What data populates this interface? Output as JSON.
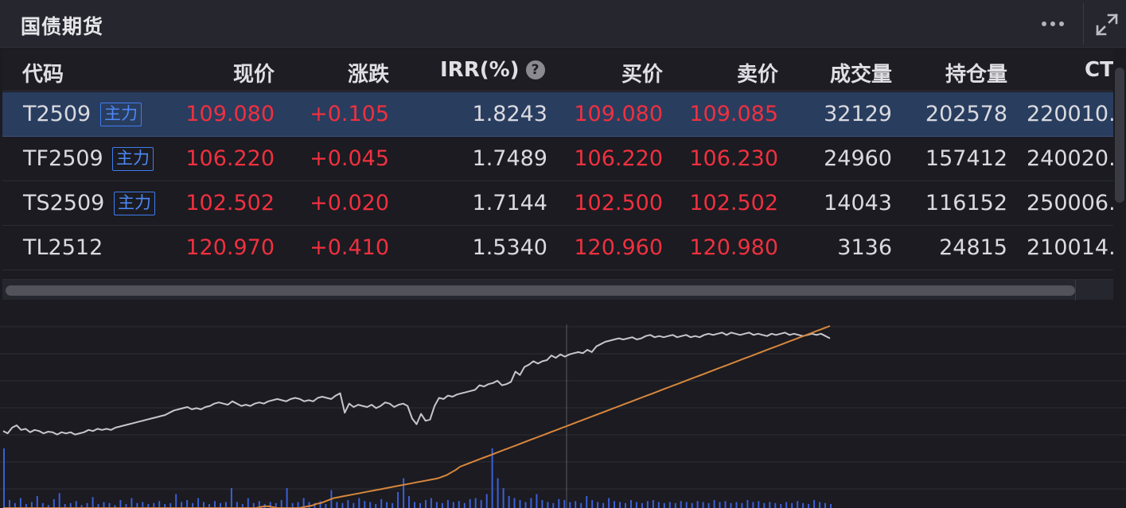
{
  "header": {
    "title": "国债期货",
    "more_icon": "more-dots-icon",
    "expand_icon": "expand-arrows-icon"
  },
  "table": {
    "columns": {
      "code": "代码",
      "price": "现价",
      "change": "涨跌",
      "irr": "IRR(%)",
      "irr_help": "?",
      "bid": "买价",
      "ask": "卖价",
      "volume": "成交量",
      "open_interest": "持仓量",
      "ctd": "CT"
    },
    "rows": [
      {
        "code": "T2509",
        "tag": "主力",
        "price": "109.080",
        "change": "+0.105",
        "irr": "1.8243",
        "bid": "109.080",
        "ask": "109.085",
        "volume": "32129",
        "open_interest": "202578",
        "ctd": "220010."
      },
      {
        "code": "TF2509",
        "tag": "主力",
        "price": "106.220",
        "change": "+0.045",
        "irr": "1.7489",
        "bid": "106.220",
        "ask": "106.230",
        "volume": "24960",
        "open_interest": "157412",
        "ctd": "240020."
      },
      {
        "code": "TS2509",
        "tag": "主力",
        "price": "102.502",
        "change": "+0.020",
        "irr": "1.7144",
        "bid": "102.500",
        "ask": "102.502",
        "volume": "14043",
        "open_interest": "116152",
        "ctd": "250006."
      },
      {
        "code": "TL2512",
        "tag": "",
        "price": "120.970",
        "change": "+0.410",
        "irr": "1.5340",
        "bid": "120.960",
        "ask": "120.980",
        "volume": "3136",
        "open_interest": "24815",
        "ctd": "210014."
      }
    ],
    "selected_row": 0
  },
  "colors": {
    "up": "#f0303f",
    "tag": "#4d88f5",
    "selected_row": "#293d5f",
    "price_line": "#c6c6cc",
    "avg_line": "#d8873c",
    "volume_bar": "#3b5fd6"
  },
  "chart_data": {
    "type": "line",
    "grid": true,
    "series": [
      {
        "values": [
          0.48,
          0.44,
          0.54,
          0.58,
          0.5,
          0.52,
          0.46,
          0.5,
          0.48,
          0.44,
          0.47,
          0.46,
          0.42,
          0.46,
          0.44,
          0.46,
          0.42,
          0.44,
          0.46,
          0.5,
          0.48,
          0.52,
          0.5,
          0.52,
          0.5,
          0.54,
          0.56,
          0.58,
          0.6,
          0.62,
          0.64,
          0.66,
          0.68,
          0.7,
          0.72,
          0.74,
          0.76,
          0.8,
          0.84,
          0.86,
          0.88,
          0.9,
          0.86,
          0.88,
          0.86,
          0.9,
          0.92,
          0.96,
          0.98,
          0.96,
          0.94,
          1.0,
          0.96,
          0.92,
          0.94,
          0.92,
          0.96,
          0.98,
          0.96,
          1.0,
          1.02,
          1.04,
          1.02,
          1.0,
          1.04,
          1.06,
          1.04,
          1.0,
          1.02,
          1.0,
          1.06,
          1.08,
          1.06,
          1.04,
          1.1,
          1.14,
          0.8,
          0.96,
          0.9,
          0.94,
          0.92,
          0.9,
          0.94,
          0.88,
          0.92,
          0.98,
          0.96,
          0.9,
          0.94,
          0.96,
          0.92,
          0.7,
          0.6,
          0.78,
          0.66,
          0.68,
          0.92,
          1.06,
          1.04,
          1.1,
          1.08,
          1.12,
          1.14,
          1.16,
          1.18,
          1.2,
          1.28,
          1.26,
          1.3,
          1.32,
          1.36,
          1.28,
          1.3,
          1.34,
          1.52,
          1.46,
          1.6,
          1.64,
          1.7,
          1.66,
          1.7,
          1.72,
          1.8,
          1.76,
          1.82,
          1.78,
          1.82,
          1.84,
          1.86,
          1.84,
          1.9,
          1.86,
          1.96,
          2.0,
          2.04,
          2.06,
          2.08,
          2.1,
          2.08,
          2.1,
          2.12,
          2.08,
          2.1,
          2.14,
          2.16,
          2.12,
          2.14,
          2.12,
          2.14,
          2.16,
          2.12,
          2.14,
          2.16,
          2.12,
          2.14,
          2.12,
          2.16,
          2.18,
          2.16,
          2.18,
          2.2,
          2.16,
          2.2,
          2.18,
          2.16,
          2.18,
          2.2,
          2.16,
          2.18,
          2.16,
          2.14,
          2.18,
          2.16,
          2.18,
          2.2,
          2.16,
          2.18,
          2.16,
          2.14,
          2.16,
          2.18,
          2.16,
          2.18,
          2.14,
          2.1
        ]
      },
      {
        "values": [
          0.0,
          0.0,
          0.0,
          0.0,
          0.0,
          0.0,
          0.0,
          0.0,
          0.0,
          0.0,
          0.0,
          0.0,
          0.0,
          0.0,
          0.0,
          0.0,
          0.0,
          0.0,
          0.0,
          0.0,
          0.0,
          0.0,
          0.0,
          0.0,
          0.0,
          0.0,
          0.0,
          0.0,
          0.0,
          0.0,
          0.0,
          0.0,
          0.0,
          0.0,
          0.0,
          0.0,
          0.0,
          0.0,
          0.0,
          0.0,
          0.0,
          0.0,
          0.0,
          0.0,
          0.0,
          0.0,
          0.0,
          0.0,
          0.0,
          0.0,
          0.0,
          0.0,
          0.0,
          0.0,
          0.0,
          0.0,
          0.0,
          0.0,
          0.0,
          0.01,
          0.02,
          0.02,
          0.01,
          0.0,
          0.0,
          0.0,
          0.0,
          0.0,
          0.0,
          0.01,
          0.02,
          0.03,
          0.05,
          0.06,
          0.08,
          0.1,
          0.12,
          0.13,
          0.14,
          0.15,
          0.16,
          0.17,
          0.18,
          0.19,
          0.2,
          0.21,
          0.22,
          0.23,
          0.24,
          0.25,
          0.26,
          0.27,
          0.28,
          0.29,
          0.3,
          0.31,
          0.32,
          0.33,
          0.34,
          0.35,
          0.36,
          0.38,
          0.4,
          0.43,
          0.46,
          0.5,
          0.52,
          0.54,
          0.56,
          0.58,
          0.6,
          0.62,
          0.64,
          0.66,
          0.68,
          0.7,
          0.72,
          0.74,
          0.76,
          0.78,
          0.8,
          0.82,
          0.84,
          0.86,
          0.88,
          0.9,
          0.92,
          0.94,
          0.96,
          0.98,
          1.0,
          1.02,
          1.04,
          1.06,
          1.08,
          1.1,
          1.12,
          1.14,
          1.16,
          1.18,
          1.2,
          1.22,
          1.24,
          1.26,
          1.28,
          1.3,
          1.32,
          1.34,
          1.36,
          1.38,
          1.4,
          1.42,
          1.44,
          1.46,
          1.48,
          1.5,
          1.52,
          1.54,
          1.56,
          1.58,
          1.6,
          1.62,
          1.64,
          1.66,
          1.68,
          1.7,
          1.72,
          1.74,
          1.76,
          1.78,
          1.8,
          1.82,
          1.84,
          1.86,
          1.88,
          1.9,
          1.92,
          1.94,
          1.96,
          1.98,
          2.0,
          2.02,
          2.04,
          2.06,
          2.08,
          2.1,
          2.12,
          2.14,
          2.16,
          2.18,
          2.2
        ]
      }
    ],
    "volume": [
      0.6,
      0.08,
      0.05,
      0.1,
      0.04,
      0.06,
      0.12,
      0.05,
      0.03,
      0.09,
      0.15,
      0.04,
      0.05,
      0.07,
      0.03,
      0.05,
      0.11,
      0.04,
      0.06,
      0.05,
      0.03,
      0.08,
      0.04,
      0.1,
      0.05,
      0.06,
      0.04,
      0.05,
      0.07,
      0.04,
      0.05,
      0.14,
      0.06,
      0.08,
      0.05,
      0.1,
      0.06,
      0.04,
      0.07,
      0.05,
      0.06,
      0.2,
      0.06,
      0.04,
      0.1,
      0.05,
      0.07,
      0.04,
      0.06,
      0.05,
      0.08,
      0.2,
      0.05,
      0.06,
      0.1,
      0.06,
      0.05,
      0.07,
      0.04,
      0.18,
      0.06,
      0.05,
      0.08,
      0.05,
      0.1,
      0.07,
      0.06,
      0.04,
      0.09,
      0.06,
      0.05,
      0.16,
      0.3,
      0.12,
      0.06,
      0.05,
      0.08,
      0.1,
      0.06,
      0.05,
      0.08,
      0.06,
      0.07,
      0.05,
      0.09,
      0.1,
      0.08,
      0.14,
      0.6,
      0.3,
      0.2,
      0.12,
      0.1,
      0.08,
      0.06,
      0.1,
      0.14,
      0.08,
      0.06,
      0.05,
      0.09,
      0.08,
      0.06,
      0.07,
      0.05,
      0.12,
      0.08,
      0.06,
      0.05,
      0.1,
      0.07,
      0.06,
      0.05,
      0.08,
      0.06,
      0.05,
      0.07,
      0.08,
      0.06,
      0.05,
      0.06,
      0.05,
      0.07,
      0.06,
      0.05,
      0.07,
      0.06,
      0.05,
      0.08,
      0.06,
      0.07,
      0.05,
      0.06,
      0.05,
      0.08,
      0.06,
      0.07,
      0.05,
      0.06,
      0.05,
      0.04,
      0.06,
      0.05,
      0.07,
      0.05,
      0.04,
      0.08,
      0.06,
      0.05,
      0.04
    ]
  }
}
